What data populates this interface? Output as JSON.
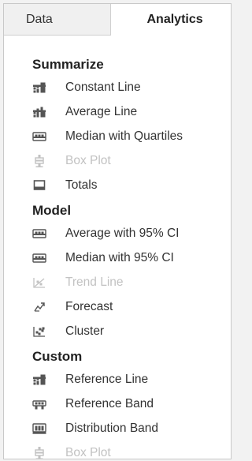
{
  "tabs": [
    {
      "label": "Data",
      "active": false
    },
    {
      "label": "Analytics",
      "active": true
    }
  ],
  "colors": {
    "text": "#333333",
    "disabled": "#c2c2c2",
    "icon": "#555555"
  },
  "sections": [
    {
      "title": "Summarize",
      "items": [
        {
          "label": "Constant Line",
          "icon": "constant-line-icon",
          "enabled": true
        },
        {
          "label": "Average Line",
          "icon": "average-line-icon",
          "enabled": true
        },
        {
          "label": "Median with Quartiles",
          "icon": "median-quartiles-icon",
          "enabled": true
        },
        {
          "label": "Box Plot",
          "icon": "box-plot-icon",
          "enabled": false
        },
        {
          "label": "Totals",
          "icon": "totals-icon",
          "enabled": true
        }
      ]
    },
    {
      "title": "Model",
      "items": [
        {
          "label": "Average with 95% CI",
          "icon": "average-ci-icon",
          "enabled": true
        },
        {
          "label": "Median with 95% CI",
          "icon": "median-ci-icon",
          "enabled": true
        },
        {
          "label": "Trend Line",
          "icon": "trend-line-icon",
          "enabled": false
        },
        {
          "label": "Forecast",
          "icon": "forecast-icon",
          "enabled": true
        },
        {
          "label": "Cluster",
          "icon": "cluster-icon",
          "enabled": true
        }
      ]
    },
    {
      "title": "Custom",
      "items": [
        {
          "label": "Reference Line",
          "icon": "reference-line-icon",
          "enabled": true
        },
        {
          "label": "Reference Band",
          "icon": "reference-band-icon",
          "enabled": true
        },
        {
          "label": "Distribution Band",
          "icon": "distribution-band-icon",
          "enabled": true
        },
        {
          "label": "Box Plot",
          "icon": "box-plot-icon",
          "enabled": false
        }
      ]
    }
  ]
}
